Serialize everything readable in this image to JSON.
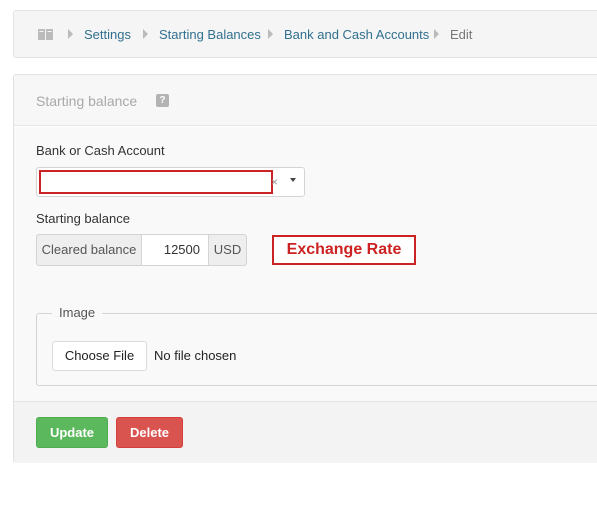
{
  "breadcrumb": {
    "icon": "book-icon",
    "items": [
      "Settings",
      "Starting Balances",
      "Bank and Cash Accounts",
      "Edit"
    ]
  },
  "panel": {
    "title": "Starting balance",
    "help_icon": "question-icon"
  },
  "form": {
    "account_label": "Bank or Cash Account",
    "account_value": "",
    "clear_symbol": "×",
    "starting_label": "Starting balance",
    "cleared_label": "Cleared balance",
    "amount": "12500",
    "currency": "USD",
    "exchange_rate_label": "Exchange Rate"
  },
  "image_field": {
    "legend": "Image",
    "button_label": "Choose File",
    "status": "No file chosen"
  },
  "actions": {
    "update_label": "Update",
    "delete_label": "Delete"
  },
  "colors": {
    "link": "#31708f",
    "update": "#5cb85c",
    "delete": "#d9534f",
    "highlight": "#cc2222"
  }
}
